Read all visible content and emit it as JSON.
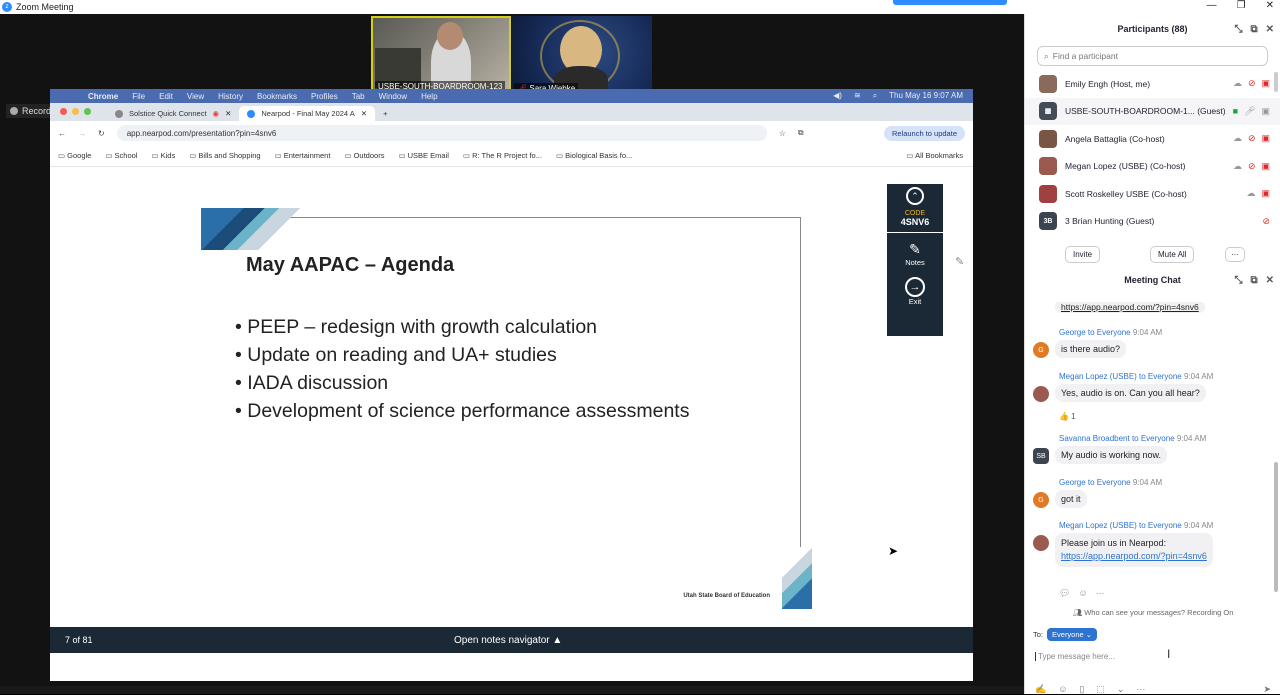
{
  "window": {
    "title": "Zoom Meeting"
  },
  "videos": [
    {
      "name": "USBE-SOUTH-BOARDROOM-123"
    },
    {
      "name": "Sara Wiebke"
    }
  ],
  "recording_label": "Recording...",
  "mac_menu": [
    "Chrome",
    "File",
    "Edit",
    "View",
    "History",
    "Bookmarks",
    "Profiles",
    "Tab",
    "Window",
    "Help"
  ],
  "mac_clock": "Thu May 16  9:07 AM",
  "browser": {
    "tabs": [
      "Solstice Quick Connect",
      "Nearpod - Final May 2024 A"
    ],
    "url": "app.nearpod.com/presentation?pin=4snv6",
    "relaunch": "Relaunch to update",
    "bookmarks": [
      "Google",
      "School",
      "Kids",
      "Bills and Shopping",
      "Entertainment",
      "Outdoors",
      "USBE Email",
      "R: The R Project fo...",
      "Biological Basis fo..."
    ],
    "all_bookmarks": "All Bookmarks"
  },
  "slide": {
    "title": "May AAPAC – Agenda",
    "bullets": [
      "PEEP – redesign with growth calculation",
      "Update on reading and UA+ studies",
      "IADA discussion",
      "Development of science performance assessments"
    ],
    "org": "Utah State Board of Education"
  },
  "nearpod": {
    "code_label": "CODE",
    "code": "4SNV6",
    "notes": "Notes",
    "exit": "Exit",
    "page": "7 of 81",
    "notes_nav": "Open notes navigator ▲"
  },
  "participants": {
    "title": "Participants (88)",
    "search_placeholder": "Find a participant",
    "list": [
      {
        "name": "Emily Engh (Host, me)",
        "initials": "",
        "color": "#8a6a5a"
      },
      {
        "name": "USBE-SOUTH-BOARDROOM-1... (Guest)",
        "initials": "",
        "color": "#444c58"
      },
      {
        "name": "Angela Battaglia (Co-host)",
        "initials": "",
        "color": "#7a5546"
      },
      {
        "name": "Megan Lopez (USBE) (Co-host)",
        "initials": "",
        "color": "#9a5a50"
      },
      {
        "name": "Scott Roskelley USBE (Co-host)",
        "initials": "",
        "color": "#a04040"
      },
      {
        "name": "3 Brian Hunting (Guest)",
        "initials": "3B",
        "color": "#3c4450"
      }
    ],
    "invite": "Invite",
    "mute_all": "Mute All",
    "more": "···"
  },
  "chat": {
    "title": "Meeting Chat",
    "top_link": "https://app.nearpod.com/?pin=4snv6",
    "messages": [
      {
        "sender": "George to Everyone",
        "time": "9:04 AM",
        "text": "is there audio?",
        "initials": "G",
        "color": "#e07a26"
      },
      {
        "sender": "Megan Lopez (USBE) to Everyone",
        "time": "9:04 AM",
        "text": "Yes, audio is on.  Can you all hear?",
        "initials": "",
        "color": "#9a5a50"
      },
      {
        "sender": "Savanna Broadbent to Everyone",
        "time": "9:04 AM",
        "text": "My audio is working now.",
        "initials": "SB",
        "color": "#3c4450"
      },
      {
        "sender": "George to Everyone",
        "time": "9:04 AM",
        "text": "got it",
        "initials": "G",
        "color": "#e07a26"
      },
      {
        "sender": "Megan Lopez (USBE) to Everyone",
        "time": "9:04 AM",
        "text": "Please join us in Nearpod:",
        "link": "https://app.nearpod.com/?pin=4snv6",
        "initials": "",
        "color": "#9a5a50"
      }
    ],
    "reaction": "👍 1",
    "who_can_see": "Who can see your messages? Recording On",
    "to_label": "To:",
    "to_value": "Everyone ⌄",
    "input_placeholder": "Type message here..."
  }
}
